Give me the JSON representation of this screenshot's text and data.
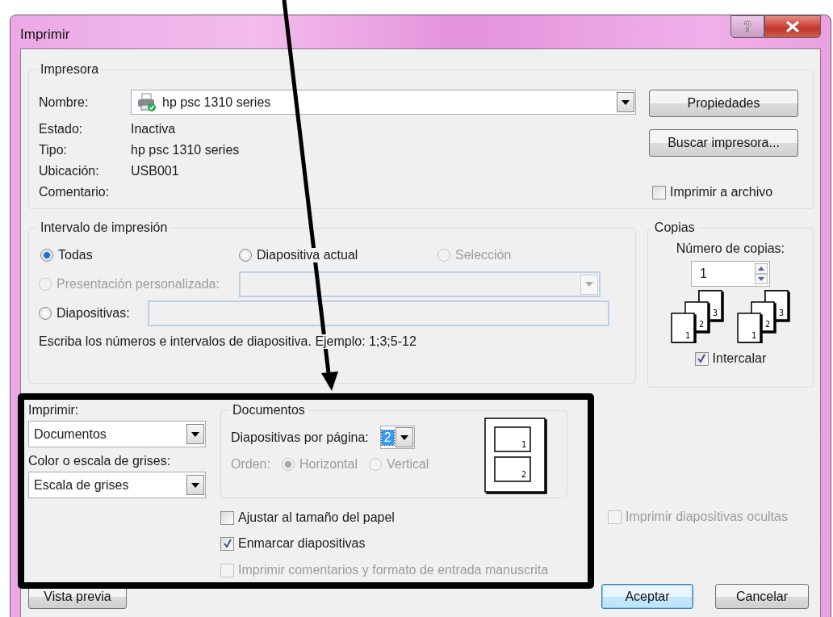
{
  "window": {
    "title": "Imprimir"
  },
  "printer": {
    "group": "Impresora",
    "name_label": "Nombre:",
    "name_value": "hp psc 1310 series",
    "info": [
      {
        "label": "Estado:",
        "value": "Inactiva"
      },
      {
        "label": "Tipo:",
        "value": "hp psc 1310 series"
      },
      {
        "label": "Ubicación:",
        "value": "USB001"
      },
      {
        "label": "Comentario:"
      }
    ],
    "buttons": [
      "Propiedades",
      "Buscar impresora..."
    ],
    "print_to_file": {
      "label": "Imprimir a archivo",
      "checked": false
    }
  },
  "print_range": {
    "group": "Intervalo de impresión",
    "options": [
      {
        "label": "Todas",
        "selected": true,
        "disabled": false
      },
      {
        "label": "Diapositiva actual",
        "selected": false,
        "disabled": false
      },
      {
        "label": "Selección",
        "selected": false,
        "disabled": true
      },
      {
        "label": "Presentación personalizada:",
        "selected": false,
        "disabled": true
      },
      {
        "label": "Diapositivas:",
        "selected": false,
        "disabled": false
      }
    ],
    "hint": "Escriba los números e intervalos de diapositiva. Ejemplo: 1;3;5-12"
  },
  "copies": {
    "group": "Copias",
    "label": "Número de copias:",
    "value": "1",
    "stacks": [
      [
        "1",
        "2",
        "3"
      ],
      [
        "1",
        "2",
        "3"
      ]
    ],
    "collate": {
      "label": "Intercalar",
      "checked": true
    }
  },
  "print_what": {
    "label": "Imprimir:",
    "value": "Documentos"
  },
  "color": {
    "label": "Color o escala de grises:",
    "value": "Escala de grises"
  },
  "handouts": {
    "group": "Documentos",
    "per_page_label": "Diapositivas por página:",
    "per_page_value": "2",
    "order_label": "Orden:",
    "order_disabled": true,
    "order_options": [
      {
        "label": "Horizontal",
        "selected": true
      },
      {
        "label": "Vertical",
        "selected": false
      }
    ],
    "preview_pages": [
      "1",
      "2"
    ]
  },
  "options": [
    {
      "label": "Ajustar al tamaño del papel",
      "checked": false,
      "disabled": false
    },
    {
      "label": "Enmarcar diapositivas",
      "checked": true,
      "disabled": false
    },
    {
      "label": "Imprimir comentarios y formato de entrada manuscrita",
      "checked": false,
      "disabled": true
    }
  ],
  "hidden_slides": {
    "label": "Imprimir diapositivas ocultas",
    "checked": false,
    "disabled": true
  },
  "footer_buttons": [
    {
      "label": "Vista previa",
      "default": false
    },
    {
      "label": "Aceptar",
      "default": true
    },
    {
      "label": "Cancelar",
      "default": false
    }
  ]
}
